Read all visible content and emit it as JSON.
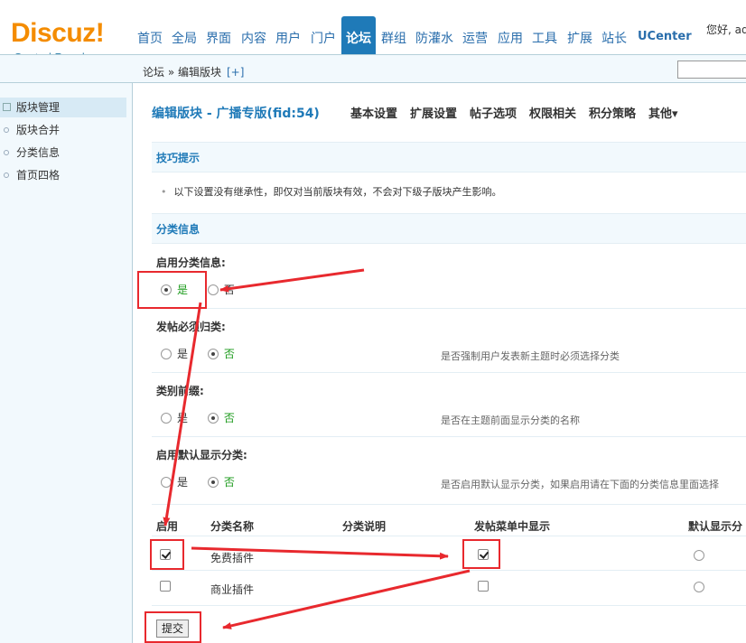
{
  "header": {
    "logo_main": "Discuz",
    "logo_bang": "!",
    "logo_sub": "Control Panel",
    "greeting": "您好, ad",
    "nav": [
      "首页",
      "全局",
      "界面",
      "内容",
      "用户",
      "门户",
      "论坛",
      "群组",
      "防灌水",
      "运营",
      "应用",
      "工具",
      "扩展",
      "站长",
      "UCenter"
    ],
    "active_nav": "论坛"
  },
  "breadcrumb": {
    "text": "论坛 » 编辑版块",
    "plus": "[+]"
  },
  "sidebar": {
    "items": [
      {
        "label": "版块管理",
        "active": true
      },
      {
        "label": "版块合并",
        "active": false
      },
      {
        "label": "分类信息",
        "active": false
      },
      {
        "label": "首页四格",
        "active": false
      }
    ]
  },
  "main": {
    "title": "编辑版块 - 广播专版(fid:54)",
    "tabs": [
      "基本设置",
      "扩展设置",
      "帖子选项",
      "权限相关",
      "积分策略",
      "其他▾"
    ],
    "tips_head": "技巧提示",
    "tip": "以下设置没有继承性，即仅对当前版块有效，不会对下级子版块产生影响。",
    "section_head": "分类信息",
    "settings": [
      {
        "label": "启用分类信息:",
        "yes": "是",
        "no": "否",
        "selected": "yes",
        "help": ""
      },
      {
        "label": "发帖必须归类:",
        "yes": "是",
        "no": "否",
        "selected": "no",
        "help": "是否强制用户发表新主题时必须选择分类"
      },
      {
        "label": "类别前缀:",
        "yes": "是",
        "no": "否",
        "selected": "no",
        "help": "是否在主题前面显示分类的名称"
      },
      {
        "label": "启用默认显示分类:",
        "yes": "是",
        "no": "否",
        "selected": "no",
        "help": "是否启用默认显示分类，如果启用请在下面的分类信息里面选择"
      }
    ],
    "table": {
      "headers": [
        "启用",
        "分类名称",
        "分类说明",
        "发帖菜单中显示",
        "默认显示分"
      ],
      "rows": [
        {
          "enabled": true,
          "name": "免费插件",
          "desc": "",
          "menu": true
        },
        {
          "enabled": false,
          "name": "商业插件",
          "desc": "",
          "menu": false
        }
      ]
    },
    "submit_label": "提交"
  },
  "colors": {
    "accent": "#1f7ab8",
    "logo": "#f48c00",
    "annotation": "#e8292e",
    "selected_option": "#1a9a1a"
  }
}
